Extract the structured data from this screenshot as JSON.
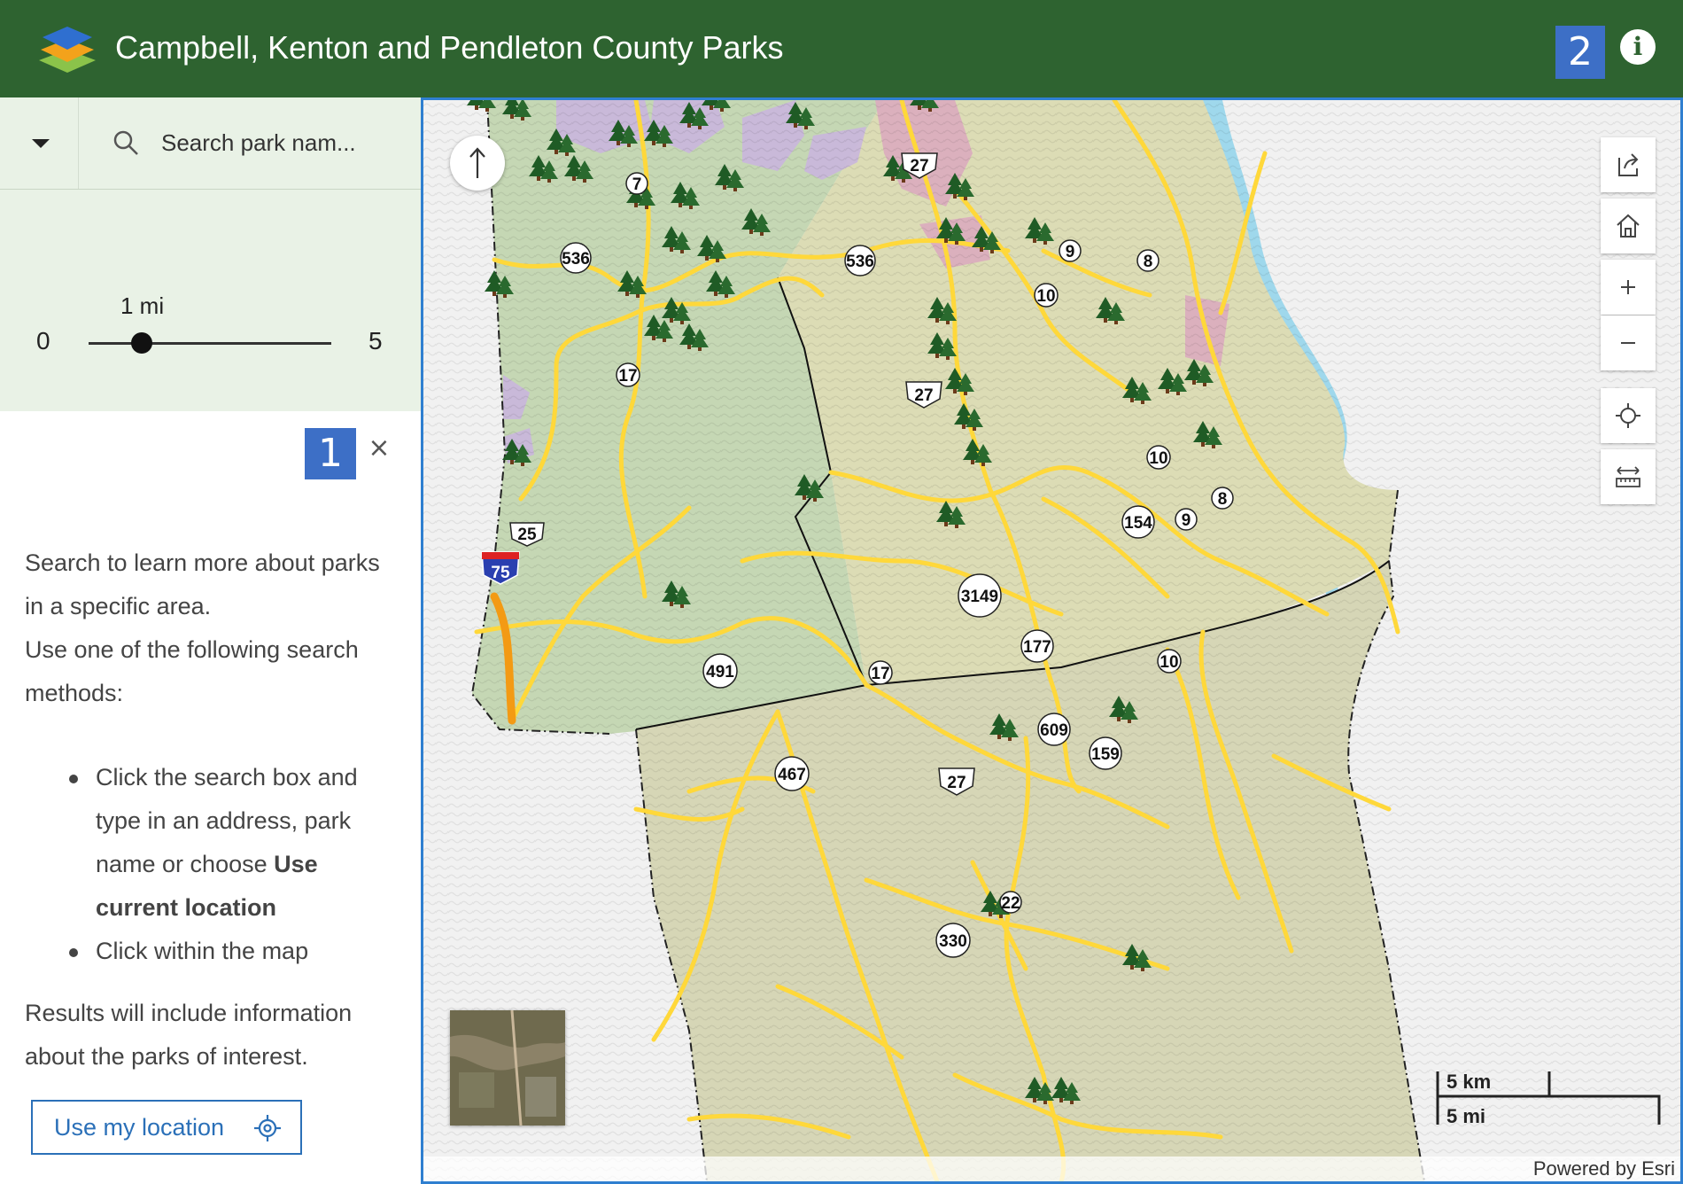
{
  "header": {
    "title": "Campbell, Kenton and Pendleton County Parks",
    "step_badge": "2",
    "info_label": "i"
  },
  "search": {
    "placeholder": "Search park nam..."
  },
  "radius": {
    "value_label": "1 mi",
    "min": "0",
    "max": "5",
    "value": 1
  },
  "panel": {
    "step_badge": "1",
    "close": "×",
    "intro_1": "Search to learn more about parks in a specific area.",
    "intro_2": "Use one of the following search methods:",
    "method_1_text": "Click the search box and type in an address, park name or choose ",
    "method_1_bold": "Use current location",
    "method_2": "Click within the map",
    "results": "Results will include information about the parks of interest.",
    "location_button": "Use my location"
  },
  "map": {
    "route_labels": [
      "536",
      "536",
      "27",
      "9",
      "8",
      "10",
      "17",
      "7",
      "27",
      "10",
      "8",
      "154",
      "9",
      "25",
      "75",
      "3149",
      "177",
      "10",
      "491",
      "17",
      "609",
      "159",
      "467",
      "27",
      "330",
      "22"
    ],
    "scale_km": "5 km",
    "scale_mi": "5 mi",
    "attribution": "Powered by Esri"
  },
  "colors": {
    "header_bg": "#2e6330",
    "accent_blue": "#3d6fc6",
    "road_yellow": "#ffd83a",
    "panel_bg": "#e9f2e6"
  },
  "icons": [
    "layers-logo-icon",
    "info-icon",
    "chevron-down-icon",
    "search-icon",
    "close-icon",
    "crosshair-icon",
    "compass-icon",
    "share-icon",
    "home-icon",
    "zoom-in-icon",
    "zoom-out-icon",
    "locate-icon",
    "measure-icon",
    "tree-icon"
  ]
}
